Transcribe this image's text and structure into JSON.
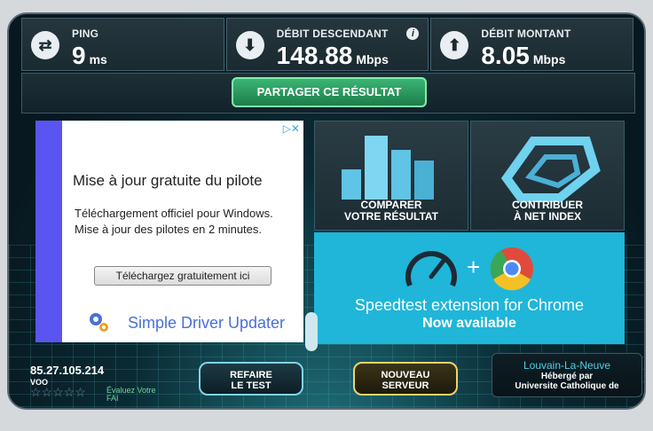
{
  "results": {
    "ping": {
      "label": "PING",
      "value": "9",
      "unit": "ms"
    },
    "download": {
      "label": "DÉBIT DESCENDANT",
      "value": "148.88",
      "unit": "Mbps"
    },
    "upload": {
      "label": "DÉBIT MONTANT",
      "value": "8.05",
      "unit": "Mbps"
    }
  },
  "share_label": "PARTAGER CE RÉSULTAT",
  "ad": {
    "title": "Mise à jour gratuite du pilote",
    "desc_line1": "Téléchargement officiel pour Windows.",
    "desc_line2": "Mise à jour des pilotes en 2 minutes.",
    "button": "Téléchargez gratuitement ici",
    "brand": "Simple Driver Updater"
  },
  "tiles": {
    "compare": {
      "line1": "COMPARER",
      "line2": "VOTRE RÉSULTAT"
    },
    "contribute": {
      "line1": "CONTRIBUER",
      "line2": "À NET INDEX"
    }
  },
  "chrome_banner": {
    "title": "Speedtest extension for Chrome",
    "subtitle": "Now available"
  },
  "bottom": {
    "ip": "85.27.105.214",
    "isp": "VOO",
    "rate_line1": "Évaluez Votre",
    "rate_line2": "FAI",
    "retest_line1": "REFAIRE",
    "retest_line2": "LE TEST",
    "newserver_line1": "NOUVEAU",
    "newserver_line2": "SERVEUR",
    "location": "Louvain-La-Neuve",
    "host_line1": "Hébergé par",
    "host_line2": "Universite Catholique de"
  },
  "colors": {
    "accent": "#1fb6d9",
    "share": "#3bb574",
    "newserver": "#d9b23a"
  }
}
